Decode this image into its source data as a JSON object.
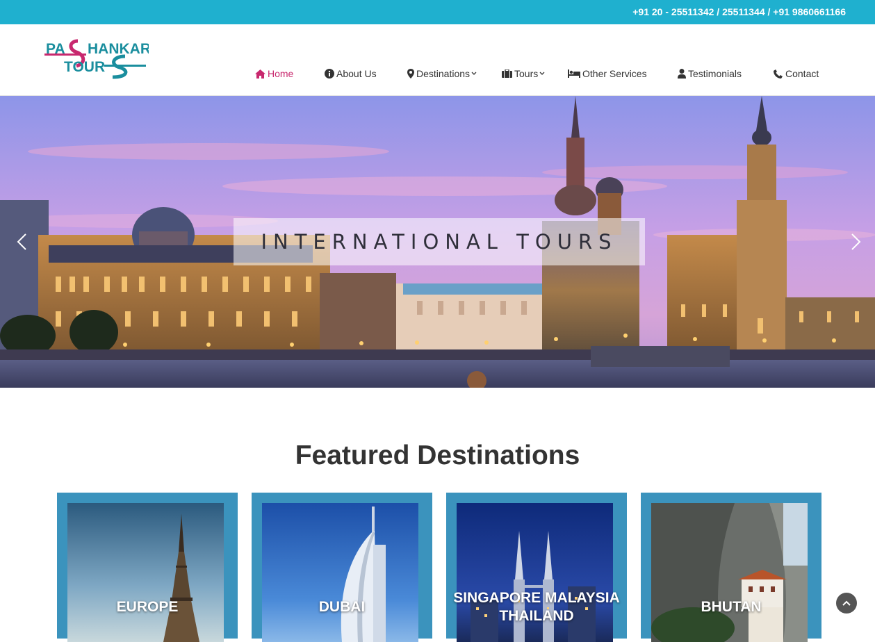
{
  "topbar": {
    "phone": "+91 20 - 25511342 / 25511344 / +91 9860661166"
  },
  "brand": {
    "line1": "PASHANKAR",
    "line2": "TOURS",
    "pink": "#c8286e",
    "teal": "#1a8e9e"
  },
  "nav": {
    "items": [
      {
        "label": "Home",
        "icon": "home-icon",
        "active": true
      },
      {
        "label": "About Us",
        "icon": "info-icon"
      },
      {
        "label": "Destinations",
        "icon": "map-marker-icon",
        "dropdown": true
      },
      {
        "label": "Tours",
        "icon": "suitcase-icon",
        "dropdown": true
      },
      {
        "label": "Other Services",
        "icon": "bed-icon"
      },
      {
        "label": "Testimonials",
        "icon": "user-icon"
      },
      {
        "label": "Contact",
        "icon": "phone-icon"
      }
    ],
    "active_color": "#c8286e"
  },
  "hero": {
    "caption": "INTERNATIONAL TOURS"
  },
  "featured": {
    "title": "Featured Destinations",
    "cards": [
      {
        "label": "EUROPE"
      },
      {
        "label": "DUBAI"
      },
      {
        "label_line1": "SINGAPORE MALAYSIA",
        "label_line2": "THAILAND"
      },
      {
        "label": "BHUTAN"
      }
    ]
  },
  "colors": {
    "topbar": "#1fb0cf",
    "card_frame": "#3b93bd"
  }
}
